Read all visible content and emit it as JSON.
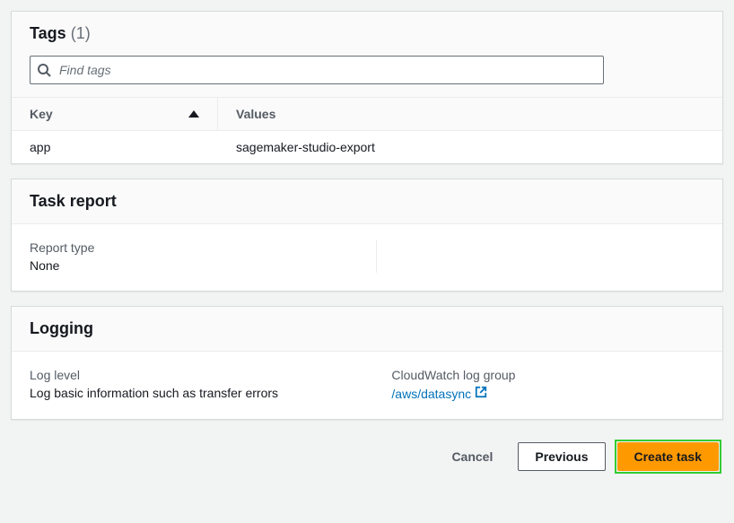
{
  "tags_panel": {
    "title": "Tags",
    "count": "(1)",
    "search_placeholder": "Find tags",
    "col_key": "Key",
    "col_values": "Values",
    "rows": [
      {
        "key": "app",
        "value": "sagemaker-studio-export"
      }
    ]
  },
  "task_report_panel": {
    "title": "Task report",
    "report_type_label": "Report type",
    "report_type_value": "None"
  },
  "logging_panel": {
    "title": "Logging",
    "log_level_label": "Log level",
    "log_level_value": "Log basic information such as transfer errors",
    "cw_group_label": "CloudWatch log group",
    "cw_group_link": "/aws/datasync"
  },
  "footer": {
    "cancel": "Cancel",
    "previous": "Previous",
    "create": "Create task"
  }
}
